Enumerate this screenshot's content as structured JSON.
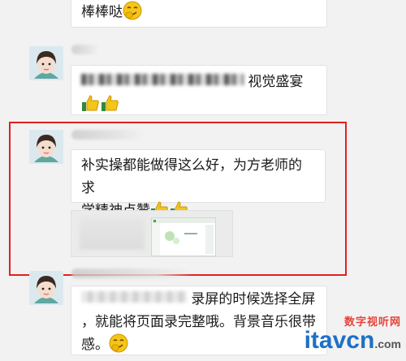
{
  "messages": [
    {
      "text": "棒棒哒",
      "emoji": "smirk-emoji"
    },
    {
      "text_visible": "视觉盛宴",
      "emoji": "thumbs-up-emoji"
    },
    {
      "line1": "补实操都能做得这么好，为方老师的求",
      "line2": "学精神点赞",
      "emoji": "thumbs-up-emoji"
    },
    {
      "line1": "录屏的时候选择全屏",
      "line2": "，就能将页面录完整哦。背景音乐很带",
      "line3": "感。",
      "emoji": "smirk-emoji"
    }
  ],
  "watermark": {
    "top": "数字视听网",
    "main": "itavcn",
    "suffix": ".com"
  },
  "colors": {
    "highlight": "#e0211e",
    "emoji_yellow": "#f5c518",
    "thumb_green": "#3fa64a"
  }
}
